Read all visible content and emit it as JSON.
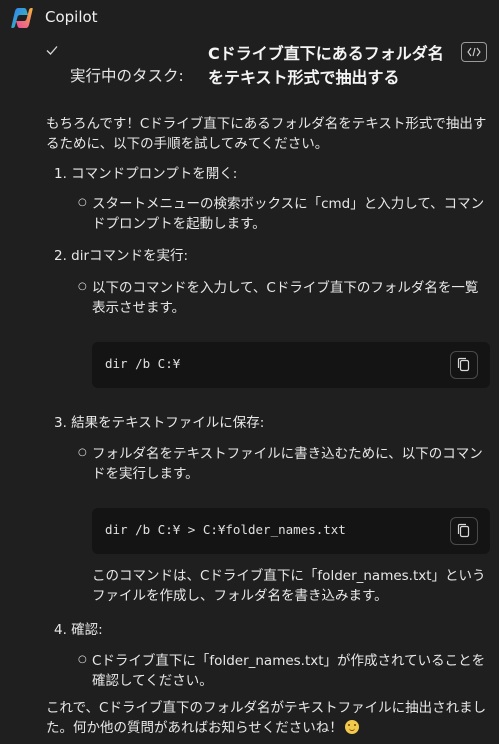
{
  "app": {
    "title": "Copilot"
  },
  "task": {
    "label": "実行中のタスク:",
    "title": "Cドライブ直下にあるフォルダ名をテキスト形式で抽出する"
  },
  "message": {
    "intro": "もちろんです！Cドライブ直下にあるフォルダ名をテキスト形式で抽出するために、以下の手順を試してみてください。",
    "steps": [
      {
        "heading": "1. コマンドプロンプトを開く:",
        "bullet": "スタートメニューの検索ボックスに「cmd」と入力して、コマンドプロンプトを起動します。"
      },
      {
        "heading": "2. dirコマンドを実行:",
        "bullet": "以下のコマンドを入力して、Cドライブ直下のフォルダ名を一覧表示させます。",
        "code": "dir /b C:¥"
      },
      {
        "heading": "3. 結果をテキストファイルに保存:",
        "bullet": "フォルダ名をテキストファイルに書き込むために、以下のコマンドを実行します。",
        "code": "dir /b C:¥ > C:¥folder_names.txt",
        "note": "このコマンドは、Cドライブ直下に「folder_names.txt」というファイルを作成し、フォルダ名を書き込みます。"
      },
      {
        "heading": "4. 確認:",
        "bullet": "Cドライブ直下に「folder_names.txt」が作成されていることを確認してください。"
      }
    ],
    "outro": "これで、Cドライブ直下のフォルダ名がテキストファイルに抽出されました。何か他の質問があればお知らせくださいね！"
  },
  "icons": {
    "logo": "copilot-logo",
    "check": "check-icon",
    "code": "code-view-icon",
    "copy": "copy-icon",
    "emoji": "smile-emoji"
  }
}
